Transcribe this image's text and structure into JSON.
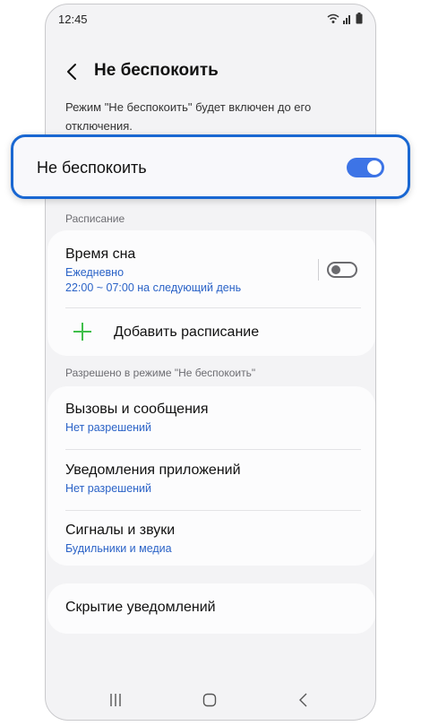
{
  "status": {
    "time": "12:45"
  },
  "header": {
    "title": "Не беспокоить"
  },
  "description": "Режим \"Не беспокоить\" будет включен до его отключения.",
  "main_toggle": {
    "label": "Не беспокоить",
    "on": true
  },
  "schedule": {
    "section_label": "Расписание",
    "sleep": {
      "title": "Время сна",
      "frequency": "Ежедневно",
      "time_range": "22:00 ~ 07:00 на следующий день",
      "on": false
    },
    "add_label": "Добавить расписание"
  },
  "allowed": {
    "section_label": "Разрешено в режиме \"Не беспокоить\"",
    "items": [
      {
        "title": "Вызовы и сообщения",
        "subtitle": "Нет разрешений"
      },
      {
        "title": "Уведомления приложений",
        "subtitle": "Нет разрешений"
      },
      {
        "title": "Сигналы и звуки",
        "subtitle": "Будильники и медиа"
      }
    ]
  },
  "hide_notifications": {
    "title": "Скрытие уведомлений"
  },
  "colors": {
    "accent": "#3d74e6",
    "link": "#2b63c7",
    "highlight_border": "#1967d2",
    "plus": "#3fbf4a"
  }
}
